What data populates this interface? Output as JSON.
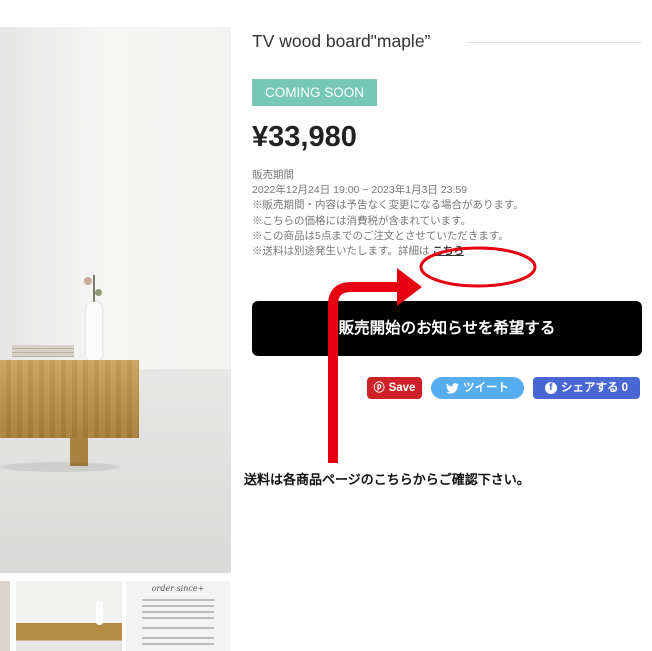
{
  "product": {
    "title": "TV wood board\"maple”",
    "badge": "COMING SOON",
    "price": "¥33,980"
  },
  "info": {
    "lines": [
      "販売期間",
      "2022年12月24日 19:00 ~ 2023年1月3日 23:59",
      "※販売期間・内容は予告なく変更になる場合があります。",
      "※こちらの価格には消費税が含まれています。",
      "※この商品は5点までのご注文とさせていただきます。"
    ],
    "shipping_text": "※送料は別途発生いたします。詳細は",
    "shipping_link": "こちら"
  },
  "cta": {
    "label": "販売開始のお知らせを希望する"
  },
  "share": {
    "pinterest": "Save",
    "twitter": "ツイート",
    "facebook": "シェアする 0"
  },
  "annotation": {
    "note": "送料は各商品ページのこちらからご確認下さい。",
    "color": "#e60012"
  },
  "thumbnails": {
    "third_caption": "order since+"
  },
  "icons": {
    "zoom": "zoom-in-icon",
    "pinterest": "pinterest-icon",
    "twitter": "twitter-bird-icon",
    "facebook": "facebook-icon"
  }
}
